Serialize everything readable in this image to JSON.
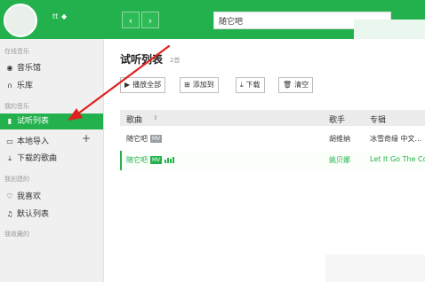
{
  "header": {
    "user_tag": "tt",
    "search": {
      "value": "随它吧"
    }
  },
  "sidebar": {
    "section_online": "在线音乐",
    "online_items": [
      {
        "label": "音乐馆",
        "icon": "disc-icon"
      },
      {
        "label": "乐库",
        "icon": "headphones-icon"
      }
    ],
    "section_mine": "我的音乐",
    "mine_items": [
      {
        "label": "试听列表",
        "icon": "bars-icon"
      },
      {
        "label": "本地导入",
        "icon": "monitor-icon"
      },
      {
        "label": "下载的歌曲",
        "icon": "download-icon"
      }
    ],
    "section_created": "我创建的",
    "created_items": [
      {
        "label": "我喜欢",
        "icon": "heart-icon"
      },
      {
        "label": "默认列表",
        "icon": "music-note-icon"
      }
    ],
    "section_collected": "我收藏的"
  },
  "main": {
    "title": "试听列表",
    "count": "2首",
    "toolbar": {
      "play_all": "播放全部",
      "add_to": "添加到",
      "download": "下载",
      "clear": "清空"
    },
    "table": {
      "headers": {
        "song": "歌曲",
        "artist": "歌手",
        "album": "专辑"
      },
      "rows": [
        {
          "song": "随它吧",
          "mv": "MV",
          "artist": "胡维纳",
          "album": "冰雪奇缘 中文..."
        },
        {
          "song": "随它吧",
          "mv": "MV",
          "artist": "姚贝娜",
          "album": "Let It Go The Co..."
        }
      ]
    }
  },
  "colors": {
    "accent": "#22b14c",
    "annotation_arrow": "#e02020"
  }
}
